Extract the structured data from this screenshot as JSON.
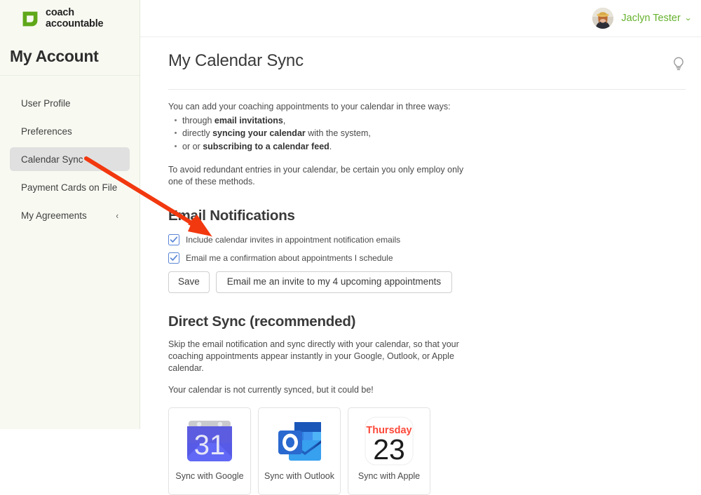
{
  "brand": {
    "line1": "coach",
    "line2": "accountable",
    "logo_color": "#5fa81a"
  },
  "sidebar": {
    "title": "My Account",
    "items": [
      {
        "label": "User Profile",
        "active": false,
        "chevron": ""
      },
      {
        "label": "Preferences",
        "active": false,
        "chevron": ""
      },
      {
        "label": "Calendar Sync",
        "active": true,
        "chevron": ""
      },
      {
        "label": "Payment Cards on File",
        "active": false,
        "chevron": ""
      },
      {
        "label": "My Agreements",
        "active": false,
        "chevron": "‹"
      }
    ]
  },
  "topbar": {
    "user_name": "Jaclyn Tester",
    "caret": "⌵",
    "user_name_color": "#66b22e"
  },
  "main": {
    "page_title": "My Calendar Sync",
    "hint_icon": "lightbulb-icon",
    "intro_lead": "You can add your coaching appointments to your calendar in three ways:",
    "intro_bullets": [
      {
        "pre": "through ",
        "bold": "email invitations",
        "post": ","
      },
      {
        "pre": "directly ",
        "bold": "syncing your calendar",
        "post": " with the system,"
      },
      {
        "pre": "or or ",
        "bold": "subscribing to a calendar feed",
        "post": "."
      }
    ],
    "intro_note": "To avoid redundant entries in your calendar, be certain you only employ only one of these methods.",
    "email_section": {
      "heading": "Email Notifications",
      "checkboxes": [
        {
          "label": "Include calendar invites in appointment notification emails",
          "checked": true
        },
        {
          "label": "Email me a confirmation about appointments I schedule",
          "checked": true
        }
      ],
      "save_label": "Save",
      "invite_label": "Email me an invite to my 4 upcoming appointments",
      "checkbox_color": "#5b86d6"
    },
    "direct_sync": {
      "heading": "Direct Sync (recommended)",
      "description": "Skip the email notification and sync directly with your calendar, so that your coaching appointments appear instantly in your Google, Outlook, or Apple calendar.",
      "status": "Your calendar is not currently synced, but it could be!",
      "cards": [
        {
          "label": "Sync with Google",
          "icon": "google-calendar-icon",
          "day_number": "31"
        },
        {
          "label": "Sync with Outlook",
          "icon": "outlook-icon",
          "letter": "O"
        },
        {
          "label": "Sync with Apple",
          "icon": "apple-calendar-icon",
          "weekday": "Thursday",
          "day_number": "23",
          "weekday_color": "#fc493a"
        }
      ]
    }
  },
  "annotation": {
    "arrow_color": "#f2380f",
    "arrow_from": "calendar-sync-nav-item",
    "arrow_to": "email-invite-button"
  }
}
